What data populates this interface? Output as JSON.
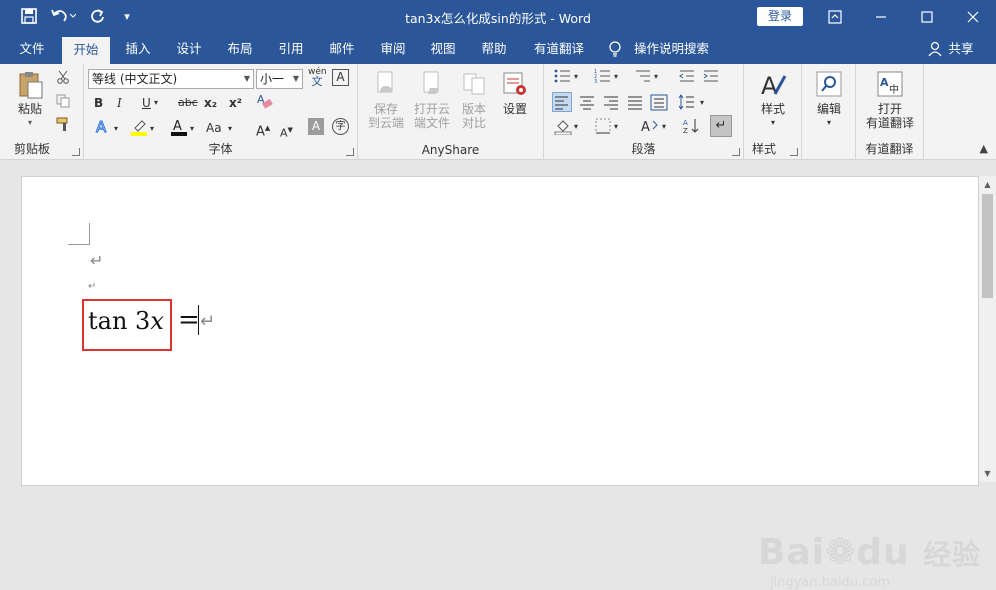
{
  "titlebar": {
    "title": "tan3x怎么化成sin的形式  -  Word",
    "login": "登录",
    "customize": "▾"
  },
  "tabs": [
    "文件",
    "开始",
    "插入",
    "设计",
    "布局",
    "引用",
    "邮件",
    "审阅",
    "视图",
    "帮助",
    "有道翻译"
  ],
  "tell_me": "操作说明搜索",
  "share": "共享",
  "ribbon": {
    "clipboard": {
      "label": "剪贴板",
      "paste": "粘贴"
    },
    "font": {
      "label": "字体",
      "font_name": "等线 (中文正文)",
      "font_size": "小一",
      "bold": "B",
      "italic": "I",
      "underline": "U",
      "strike": "abc",
      "sub": "x₂",
      "sup": "x²",
      "grow": "A",
      "shrink": "A",
      "case": "Aa",
      "wen": "wén",
      "char_border": "A",
      "shade_a": "A",
      "circle": "字"
    },
    "anyshare": {
      "label": "AnyShare",
      "save_cloud": [
        "保存",
        "到云端"
      ],
      "open_cloud": [
        "打开云",
        "端文件"
      ],
      "version": [
        "版本",
        "对比"
      ],
      "settings": "设置"
    },
    "paragraph": {
      "label": "段落"
    },
    "styles": {
      "label": "样式",
      "styles_btn": "样式"
    },
    "editing": {
      "edit_btn": "编辑"
    },
    "youdao": {
      "label": "有道翻译",
      "open": [
        "打开",
        "有道翻译"
      ]
    }
  },
  "document": {
    "equation_func": "tan 3",
    "equation_var": "x",
    "equals": "="
  },
  "watermark": {
    "line1": "Bai",
    "line2": "du",
    "line3": "经验",
    "url": "jingyan.baidu.com"
  },
  "colors": {
    "accent": "#2b579a",
    "highlight": "#d33"
  }
}
